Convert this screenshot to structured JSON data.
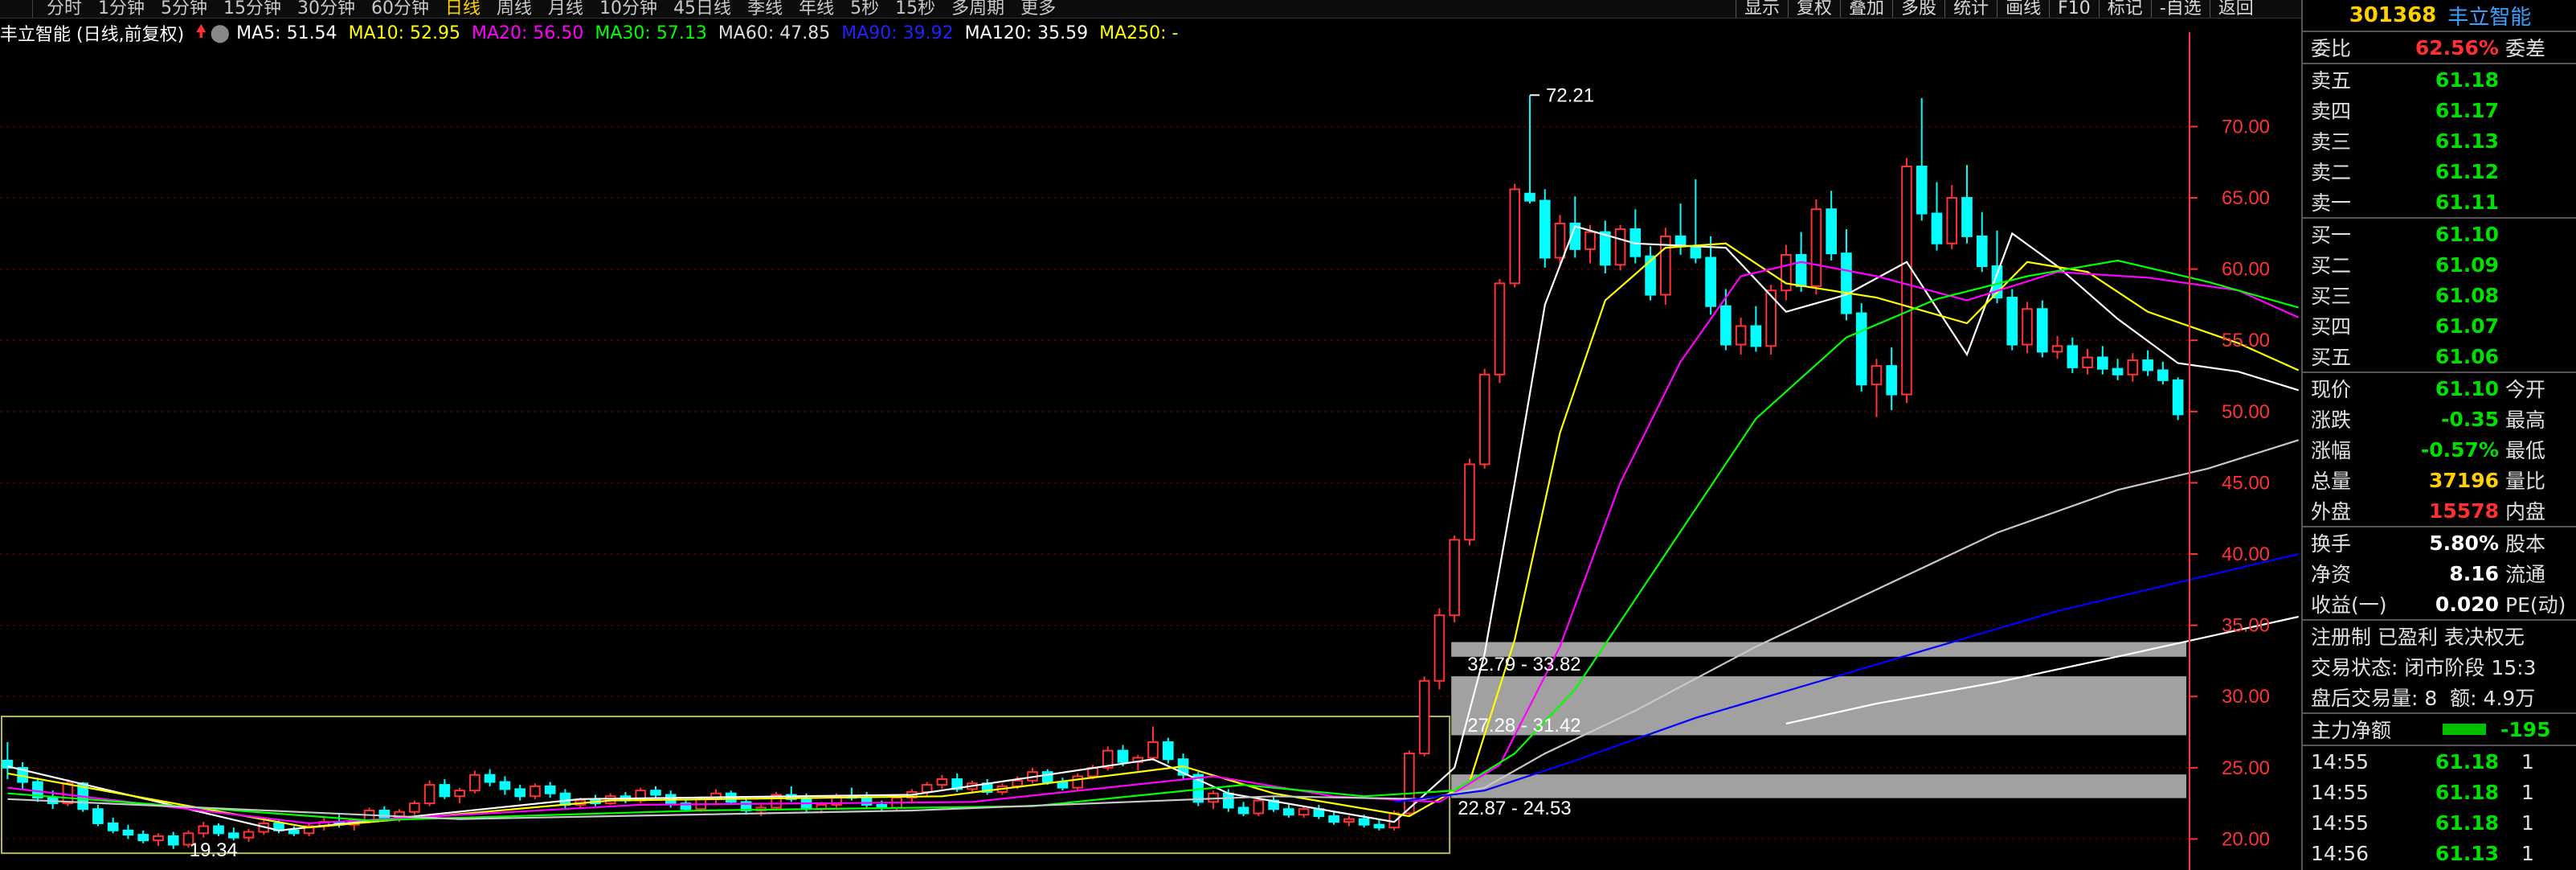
{
  "period_tabs": [
    "分时",
    "1分钟",
    "5分钟",
    "15分钟",
    "30分钟",
    "60分钟",
    "日线",
    "周线",
    "月线",
    "10分钟",
    "45日线",
    "季线",
    "年线",
    "5秒",
    "15秒",
    "多周期",
    "更多"
  ],
  "active_period": "日线",
  "tool_buttons": [
    "显示",
    "复权",
    "叠加",
    "多股",
    "统计",
    "画线",
    "F10",
    "标记",
    "-自选",
    "返回"
  ],
  "legend": {
    "title": "丰立智能 (日线,前复权)",
    "ma5": "MA5: 51.54",
    "ma10": "MA10: 52.95",
    "ma20": "MA20: 56.50",
    "ma30": "MA30: 57.13",
    "ma60": "MA60: 47.85",
    "ma90": "MA90: 39.92",
    "ma120": "MA120: 35.59",
    "ma250": "MA250: -"
  },
  "annotations": {
    "high": "72.21",
    "low": "19.34",
    "zone1": "32.79 - 33.82",
    "zone2": "27.28 - 31.42",
    "zone3": "22.87 - 24.53"
  },
  "colors": {
    "up": "#ff3333",
    "down": "#00ffff",
    "ma5": "#ffffff",
    "ma10": "#ffff00",
    "ma20": "#ff00ff",
    "ma30": "#00ff00",
    "ma60": "#c8c8c8",
    "ma90": "#0000ff",
    "ma120": "#ffffff",
    "ma250": "#ffff00",
    "axis": "#ff3333",
    "grid": "#550000"
  },
  "chart_data": {
    "type": "candlestick",
    "y_ticks": [
      "70.00",
      "65.00",
      "60.00",
      "55.00",
      "50.00",
      "45.00",
      "40.00",
      "35.00",
      "30.00",
      "25.00",
      "20.00"
    ],
    "ylim": [
      18.5,
      75.5
    ],
    "candles": [
      [
        25.5,
        26.8,
        24.2,
        25.0
      ],
      [
        25.0,
        25.4,
        23.5,
        24.0
      ],
      [
        24.0,
        24.3,
        22.6,
        22.9
      ],
      [
        22.9,
        23.4,
        22.1,
        22.5
      ],
      [
        22.5,
        24.2,
        22.3,
        23.9
      ],
      [
        23.9,
        24.0,
        21.9,
        22.1
      ],
      [
        22.1,
        22.4,
        20.9,
        21.1
      ],
      [
        21.1,
        21.5,
        20.4,
        20.6
      ],
      [
        20.6,
        21.0,
        20.0,
        20.3
      ],
      [
        20.3,
        20.6,
        19.7,
        19.9
      ],
      [
        19.9,
        20.4,
        19.5,
        20.2
      ],
      [
        20.2,
        20.5,
        19.3,
        19.6
      ],
      [
        19.6,
        20.6,
        19.4,
        20.4
      ],
      [
        20.4,
        21.2,
        20.1,
        20.9
      ],
      [
        20.9,
        21.1,
        20.2,
        20.4
      ],
      [
        20.4,
        20.8,
        19.9,
        20.1
      ],
      [
        20.1,
        20.7,
        19.8,
        20.5
      ],
      [
        20.5,
        21.3,
        20.3,
        21.1
      ],
      [
        21.1,
        21.4,
        20.4,
        20.6
      ],
      [
        20.6,
        20.9,
        20.2,
        20.4
      ],
      [
        20.4,
        21.1,
        20.2,
        20.9
      ],
      [
        20.9,
        21.5,
        20.6,
        21.2
      ],
      [
        21.2,
        21.7,
        20.8,
        21.0
      ],
      [
        21.0,
        21.4,
        20.6,
        21.3
      ],
      [
        21.3,
        22.2,
        21.1,
        22.0
      ],
      [
        22.0,
        22.3,
        21.3,
        21.5
      ],
      [
        21.5,
        22.1,
        21.2,
        21.9
      ],
      [
        21.9,
        22.7,
        21.7,
        22.5
      ],
      [
        22.5,
        24.1,
        22.3,
        23.8
      ],
      [
        23.8,
        24.2,
        22.8,
        23.0
      ],
      [
        23.0,
        23.6,
        22.5,
        23.4
      ],
      [
        23.4,
        24.8,
        23.2,
        24.5
      ],
      [
        24.5,
        24.9,
        23.7,
        24.0
      ],
      [
        24.0,
        24.4,
        23.1,
        23.5
      ],
      [
        23.5,
        23.8,
        22.7,
        23.0
      ],
      [
        23.0,
        23.9,
        22.8,
        23.7
      ],
      [
        23.7,
        24.0,
        22.9,
        23.2
      ],
      [
        23.2,
        23.5,
        22.1,
        22.4
      ],
      [
        22.4,
        22.9,
        22.1,
        22.7
      ],
      [
        22.7,
        23.1,
        22.3,
        22.5
      ],
      [
        22.5,
        23.2,
        22.4,
        23.0
      ],
      [
        23.0,
        23.3,
        22.5,
        22.7
      ],
      [
        22.7,
        23.6,
        22.5,
        23.4
      ],
      [
        23.4,
        23.7,
        22.9,
        23.1
      ],
      [
        23.1,
        23.4,
        22.2,
        22.5
      ],
      [
        22.5,
        22.8,
        21.9,
        22.1
      ],
      [
        22.1,
        23.0,
        21.9,
        22.8
      ],
      [
        22.8,
        23.5,
        22.5,
        23.2
      ],
      [
        23.2,
        23.4,
        22.4,
        22.6
      ],
      [
        22.6,
        22.9,
        21.7,
        22.0
      ],
      [
        22.0,
        22.4,
        21.6,
        22.2
      ],
      [
        22.2,
        23.3,
        22.0,
        23.1
      ],
      [
        23.1,
        23.7,
        22.6,
        22.8
      ],
      [
        22.8,
        23.2,
        21.9,
        22.1
      ],
      [
        22.1,
        22.6,
        21.8,
        22.4
      ],
      [
        22.4,
        23.2,
        22.2,
        23.0
      ],
      [
        23.0,
        23.6,
        22.7,
        22.9
      ],
      [
        22.9,
        23.3,
        22.2,
        22.4
      ],
      [
        22.4,
        22.7,
        21.9,
        22.2
      ],
      [
        22.2,
        23.1,
        22.0,
        22.9
      ],
      [
        22.9,
        23.5,
        22.6,
        23.3
      ],
      [
        23.3,
        24.0,
        23.0,
        23.8
      ],
      [
        23.8,
        24.5,
        23.5,
        24.2
      ],
      [
        24.2,
        24.6,
        23.3,
        23.5
      ],
      [
        23.5,
        24.1,
        23.2,
        23.9
      ],
      [
        23.9,
        24.2,
        23.1,
        23.3
      ],
      [
        23.3,
        23.9,
        23.1,
        23.7
      ],
      [
        23.7,
        24.4,
        23.5,
        24.1
      ],
      [
        24.1,
        25.0,
        23.9,
        24.7
      ],
      [
        24.7,
        24.9,
        23.8,
        24.0
      ],
      [
        24.0,
        24.3,
        23.4,
        23.6
      ],
      [
        23.6,
        24.6,
        23.4,
        24.4
      ],
      [
        24.4,
        25.2,
        24.2,
        25.0
      ],
      [
        25.0,
        26.5,
        24.8,
        26.2
      ],
      [
        26.2,
        26.6,
        25.1,
        25.4
      ],
      [
        25.4,
        25.9,
        24.8,
        25.7
      ],
      [
        25.7,
        27.9,
        25.5,
        26.8
      ],
      [
        26.8,
        27.1,
        25.3,
        25.6
      ],
      [
        25.6,
        26.0,
        24.2,
        24.5
      ],
      [
        24.5,
        24.7,
        22.3,
        22.6
      ],
      [
        22.6,
        23.4,
        22.1,
        23.2
      ],
      [
        23.2,
        23.5,
        21.9,
        22.2
      ],
      [
        22.2,
        22.6,
        21.6,
        21.8
      ],
      [
        21.8,
        22.9,
        21.6,
        22.7
      ],
      [
        22.7,
        23.0,
        21.9,
        22.1
      ],
      [
        22.1,
        22.4,
        21.5,
        21.7
      ],
      [
        21.7,
        22.3,
        21.5,
        22.1
      ],
      [
        22.1,
        22.4,
        21.4,
        21.6
      ],
      [
        21.6,
        21.9,
        21.0,
        21.2
      ],
      [
        21.2,
        21.6,
        20.9,
        21.4
      ],
      [
        21.4,
        21.7,
        20.8,
        21.0
      ],
      [
        21.0,
        21.4,
        20.6,
        20.8
      ],
      [
        20.8,
        22.0,
        20.6,
        21.8
      ],
      [
        21.8,
        26.2,
        21.6,
        26.0
      ],
      [
        26.0,
        31.4,
        25.8,
        31.1
      ],
      [
        31.1,
        36.2,
        30.5,
        35.7
      ],
      [
        35.7,
        41.3,
        35.2,
        41.0
      ],
      [
        41.0,
        46.7,
        40.6,
        46.3
      ],
      [
        46.3,
        53.0,
        46.0,
        52.6
      ],
      [
        52.6,
        59.3,
        52.0,
        59.0
      ],
      [
        59.0,
        66.0,
        58.7,
        65.6
      ],
      [
        65.3,
        72.2,
        64.6,
        64.8
      ],
      [
        64.8,
        65.6,
        60.1,
        60.8
      ],
      [
        60.8,
        63.8,
        60.3,
        63.2
      ],
      [
        63.2,
        65.1,
        60.8,
        61.4
      ],
      [
        61.4,
        63.1,
        60.4,
        62.6
      ],
      [
        62.6,
        63.4,
        59.7,
        60.3
      ],
      [
        60.3,
        63.1,
        59.9,
        62.8
      ],
      [
        62.8,
        64.2,
        60.4,
        60.9
      ],
      [
        60.9,
        61.6,
        57.8,
        58.2
      ],
      [
        58.2,
        62.9,
        57.5,
        62.3
      ],
      [
        62.3,
        64.6,
        61.0,
        61.6
      ],
      [
        61.6,
        66.3,
        60.4,
        60.8
      ],
      [
        60.8,
        62.3,
        56.8,
        57.4
      ],
      [
        57.4,
        58.6,
        54.3,
        54.7
      ],
      [
        54.7,
        56.6,
        54.0,
        56.0
      ],
      [
        56.0,
        57.4,
        54.2,
        54.6
      ],
      [
        54.6,
        58.9,
        54.0,
        58.5
      ],
      [
        58.5,
        61.7,
        57.8,
        61.0
      ],
      [
        61.0,
        62.6,
        58.4,
        58.8
      ],
      [
        58.8,
        64.9,
        58.2,
        64.2
      ],
      [
        64.2,
        65.5,
        60.6,
        61.1
      ],
      [
        61.1,
        62.8,
        56.4,
        56.9
      ],
      [
        56.9,
        57.6,
        51.4,
        51.9
      ],
      [
        51.9,
        53.7,
        49.6,
        53.2
      ],
      [
        53.2,
        54.5,
        50.1,
        51.2
      ],
      [
        51.2,
        67.8,
        50.6,
        67.2
      ],
      [
        67.2,
        72.0,
        63.4,
        63.9
      ],
      [
        63.9,
        66.1,
        61.3,
        61.8
      ],
      [
        61.8,
        65.9,
        61.4,
        65.0
      ],
      [
        65.0,
        67.3,
        61.8,
        62.3
      ],
      [
        62.3,
        64.0,
        59.8,
        60.2
      ],
      [
        60.2,
        62.7,
        57.6,
        58.0
      ],
      [
        58.0,
        58.6,
        54.3,
        54.7
      ],
      [
        54.7,
        57.7,
        54.1,
        57.2
      ],
      [
        57.2,
        57.8,
        53.8,
        54.2
      ],
      [
        54.2,
        55.3,
        53.7,
        54.6
      ],
      [
        54.6,
        55.2,
        52.7,
        53.1
      ],
      [
        53.1,
        54.4,
        52.6,
        53.8
      ],
      [
        53.8,
        54.6,
        52.6,
        53.0
      ],
      [
        53.0,
        53.7,
        52.2,
        52.6
      ],
      [
        52.6,
        54.1,
        52.1,
        53.6
      ],
      [
        53.6,
        54.3,
        52.5,
        52.9
      ],
      [
        52.9,
        53.5,
        51.9,
        52.2
      ],
      [
        52.2,
        52.4,
        49.4,
        49.8
      ]
    ],
    "ma": {
      "ma5": [
        [
          0,
          25.1
        ],
        [
          18,
          20.6
        ],
        [
          38,
          22.8
        ],
        [
          60,
          23.1
        ],
        [
          76,
          25.6
        ],
        [
          81,
          23.2
        ],
        [
          92,
          21.2
        ],
        [
          96,
          25.0
        ],
        [
          98,
          33.0
        ],
        [
          100,
          45.0
        ],
        [
          102,
          57.5
        ],
        [
          104,
          63.0
        ],
        [
          108,
          61.8
        ],
        [
          114,
          61.5
        ],
        [
          118,
          57.0
        ],
        [
          122,
          58.2
        ],
        [
          126,
          60.5
        ],
        [
          130,
          54.0
        ],
        [
          133,
          62.5
        ],
        [
          136,
          60.2
        ],
        [
          140,
          56.5
        ],
        [
          144,
          53.4
        ],
        [
          148,
          52.8
        ],
        [
          152,
          51.5
        ]
      ],
      "ma10": [
        [
          0,
          24.6
        ],
        [
          20,
          20.8
        ],
        [
          40,
          22.7
        ],
        [
          62,
          23.0
        ],
        [
          78,
          25.1
        ],
        [
          84,
          23.2
        ],
        [
          93,
          21.6
        ],
        [
          97,
          24.0
        ],
        [
          100,
          34.0
        ],
        [
          103,
          48.5
        ],
        [
          106,
          57.8
        ],
        [
          110,
          61.5
        ],
        [
          114,
          61.8
        ],
        [
          118,
          59.0
        ],
        [
          124,
          58.0
        ],
        [
          130,
          56.2
        ],
        [
          134,
          60.5
        ],
        [
          138,
          59.8
        ],
        [
          142,
          57.0
        ],
        [
          148,
          54.8
        ],
        [
          152,
          52.9
        ]
      ],
      "ma20": [
        [
          0,
          23.6
        ],
        [
          20,
          21.1
        ],
        [
          42,
          22.4
        ],
        [
          64,
          22.6
        ],
        [
          80,
          24.4
        ],
        [
          88,
          23.0
        ],
        [
          95,
          22.6
        ],
        [
          99,
          25.2
        ],
        [
          103,
          33.5
        ],
        [
          107,
          45.0
        ],
        [
          111,
          53.5
        ],
        [
          115,
          59.5
        ],
        [
          119,
          60.5
        ],
        [
          124,
          59.5
        ],
        [
          130,
          57.8
        ],
        [
          136,
          59.8
        ],
        [
          142,
          59.4
        ],
        [
          148,
          58.5
        ],
        [
          152,
          56.6
        ]
      ],
      "ma30": [
        [
          0,
          23.2
        ],
        [
          24,
          21.3
        ],
        [
          46,
          22.0
        ],
        [
          68,
          22.3
        ],
        [
          82,
          23.8
        ],
        [
          90,
          23.0
        ],
        [
          96,
          23.4
        ],
        [
          100,
          26.0
        ],
        [
          104,
          30.5
        ],
        [
          110,
          40.0
        ],
        [
          116,
          49.5
        ],
        [
          122,
          55.2
        ],
        [
          128,
          57.9
        ],
        [
          134,
          59.5
        ],
        [
          140,
          60.6
        ],
        [
          146,
          59.1
        ],
        [
          152,
          57.3
        ]
      ],
      "ma60": [
        [
          0,
          22.8
        ],
        [
          30,
          21.4
        ],
        [
          60,
          22.0
        ],
        [
          84,
          23.0
        ],
        [
          94,
          22.8
        ],
        [
          98,
          23.6
        ],
        [
          102,
          26.0
        ],
        [
          108,
          29.0
        ],
        [
          116,
          33.5
        ],
        [
          124,
          37.5
        ],
        [
          132,
          41.5
        ],
        [
          140,
          44.5
        ],
        [
          146,
          46.0
        ],
        [
          152,
          48.0
        ]
      ],
      "ma90": [
        [
          92,
          22.6
        ],
        [
          98,
          23.4
        ],
        [
          104,
          25.5
        ],
        [
          112,
          28.5
        ],
        [
          120,
          31.0
        ],
        [
          128,
          33.5
        ],
        [
          136,
          36.0
        ],
        [
          144,
          38.0
        ],
        [
          152,
          40.0
        ]
      ],
      "ma120": [
        [
          118,
          28.1
        ],
        [
          124,
          29.5
        ],
        [
          132,
          31.0
        ],
        [
          140,
          32.8
        ],
        [
          146,
          34.2
        ],
        [
          152,
          35.6
        ]
      ]
    }
  }
}
